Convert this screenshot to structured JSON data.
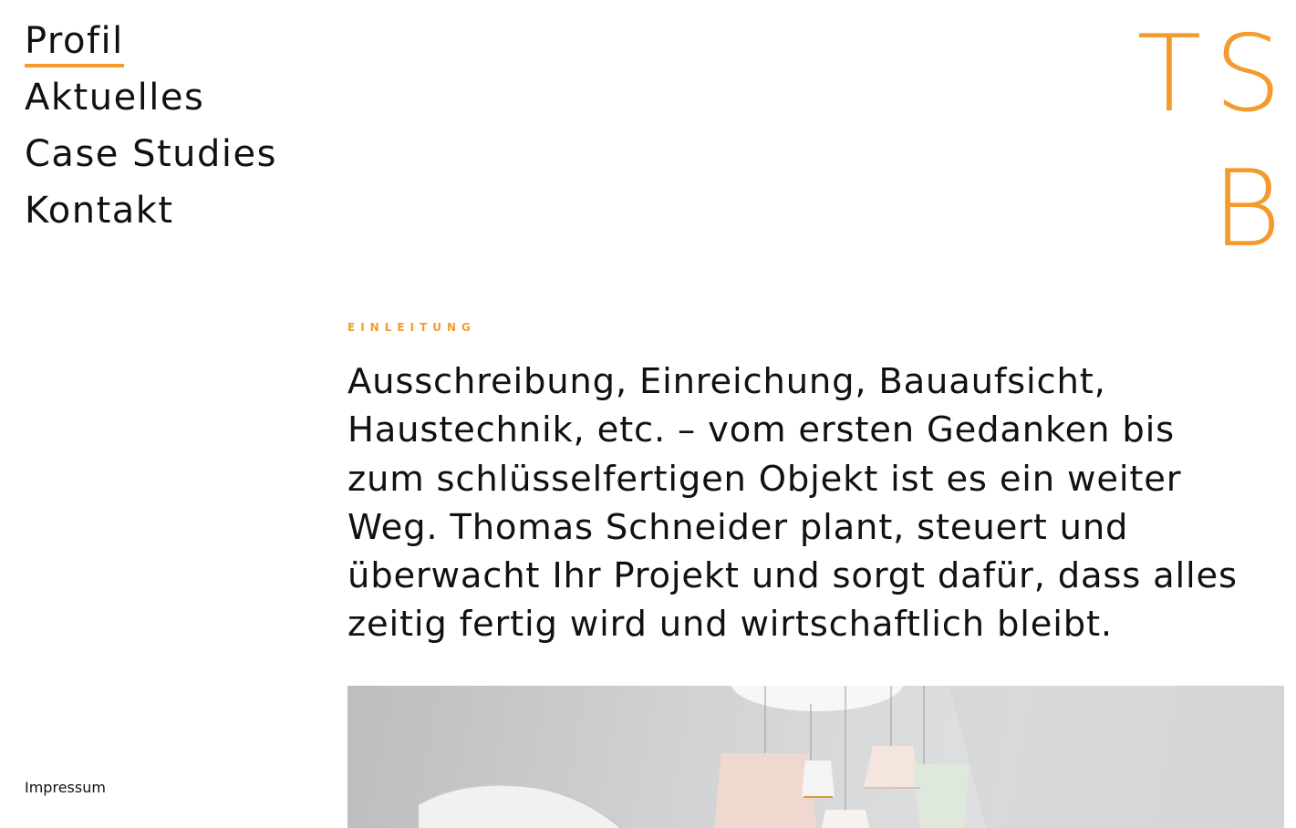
{
  "nav": {
    "items": [
      {
        "label": "Profil",
        "active": true
      },
      {
        "label": "Aktuelles",
        "active": false
      },
      {
        "label": "Case Studies",
        "active": false
      },
      {
        "label": "Kontakt",
        "active": false
      }
    ]
  },
  "logo": {
    "line1": "TS",
    "line2": "B"
  },
  "intro": {
    "label": "EINLEITUNG",
    "lines": [
      "Ausschreibung, Einreichung, Bauaufsicht,",
      "Haustechnik, etc. – vom ersten Gedanken bis",
      "zum schlüsselfertigen Objekt ist es ein weiter",
      "Weg. Thomas Schneider plant, steuert und",
      "überwacht Ihr Projekt und sorgt dafür, dass alles",
      "zeitig fertig wird und wirtschaftlich bleibt."
    ]
  },
  "footer": {
    "impressum": "Impressum"
  },
  "colors": {
    "accent": "#f39b2c",
    "text": "#111111",
    "background": "#ffffff"
  }
}
